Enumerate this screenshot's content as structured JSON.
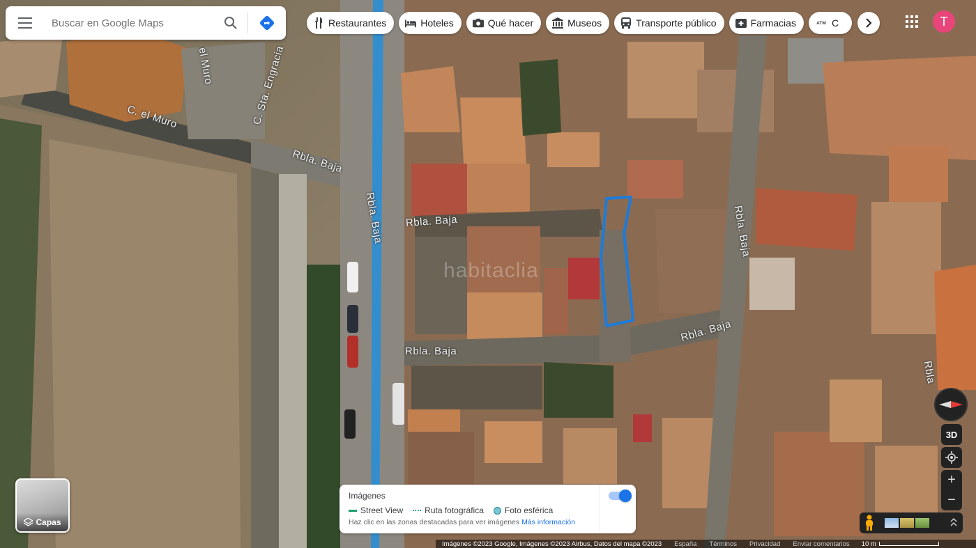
{
  "search": {
    "placeholder": "Buscar en Google Maps"
  },
  "chips": [
    {
      "label": "Restaurantes",
      "icon": "restaurant-icon"
    },
    {
      "label": "Hoteles",
      "icon": "hotel-bed-icon"
    },
    {
      "label": "Qué hacer",
      "icon": "camera-icon"
    },
    {
      "label": "Museos",
      "icon": "museum-icon"
    },
    {
      "label": "Transporte público",
      "icon": "bus-icon"
    },
    {
      "label": "Farmacias",
      "icon": "pharmacy-icon"
    },
    {
      "label": "C",
      "icon": "atm-icon"
    }
  ],
  "chip_atm_text": "ATM",
  "account": {
    "initial": "T",
    "color": "#e8457b"
  },
  "map": {
    "streets": [
      "C. el Muro",
      "C. Sta. Engracia",
      "Rbla. Baja",
      "Rbla. Baja",
      "Rbla. Baja",
      "Rbla. Baja",
      "Rbla. Baja",
      "Rbla. Baja",
      "Rbla"
    ],
    "watermark": "habitaclia",
    "street_partial": "el Muro",
    "parcel_color": "#1e7bd8"
  },
  "layers": {
    "label": "Capas"
  },
  "streetview_panel": {
    "title": "Imágenes",
    "legend": [
      "Street View",
      "Ruta fotográfica",
      "Foto esférica"
    ],
    "help": "Haz clic en las zonas destacadas para ver imágenes",
    "more": "Más información",
    "toggle_on": true
  },
  "controls": {
    "three_d": "3D",
    "zoom_in": "+",
    "zoom_out": "−"
  },
  "footer": {
    "imagery": "Imágenes ©2023 Google, Imágenes ©2023 Airbus, Datos del mapa ©2023",
    "country": "España",
    "terms": "Términos",
    "privacy": "Privacidad",
    "feedback": "Enviar comentarios",
    "scale": "10 m"
  }
}
